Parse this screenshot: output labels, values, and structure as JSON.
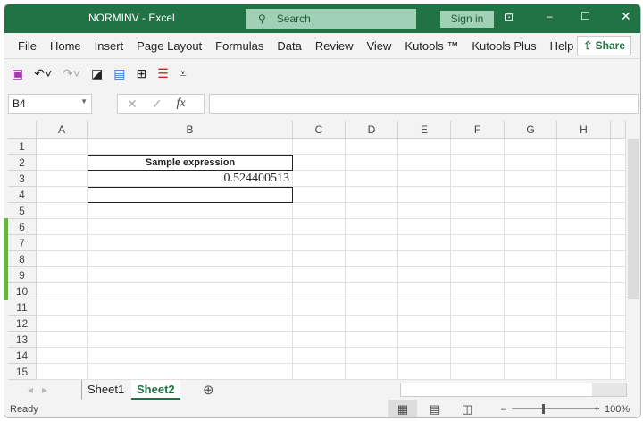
{
  "window": {
    "doc_title": "NORMINV",
    "app": "Excel",
    "search_placeholder": "Search",
    "sign_in": "Sign in"
  },
  "ribbon": {
    "tabs": [
      "File",
      "Home",
      "Insert",
      "Page Layout",
      "Formulas",
      "Data",
      "Review",
      "View",
      "Kutools ™",
      "Kutools Plus",
      "Help"
    ],
    "share": "Share"
  },
  "formula_bar": {
    "name_box": "B4",
    "formula": "",
    "fx": "fx"
  },
  "grid": {
    "columns": [
      "A",
      "B",
      "C",
      "D",
      "E",
      "F",
      "G",
      "H"
    ],
    "rows": [
      "1",
      "2",
      "3",
      "4",
      "5",
      "6",
      "7",
      "8",
      "9",
      "10",
      "11",
      "12",
      "13",
      "14",
      "15"
    ],
    "cells": {
      "B2": "Sample expression",
      "B3": "0.524400513"
    },
    "selected": "B4"
  },
  "sheets": {
    "tabs": [
      "Sheet1",
      "Sheet2"
    ],
    "active": "Sheet2"
  },
  "status": {
    "text": "Ready",
    "zoom": "100%"
  },
  "colors": {
    "accent": "#217346"
  }
}
